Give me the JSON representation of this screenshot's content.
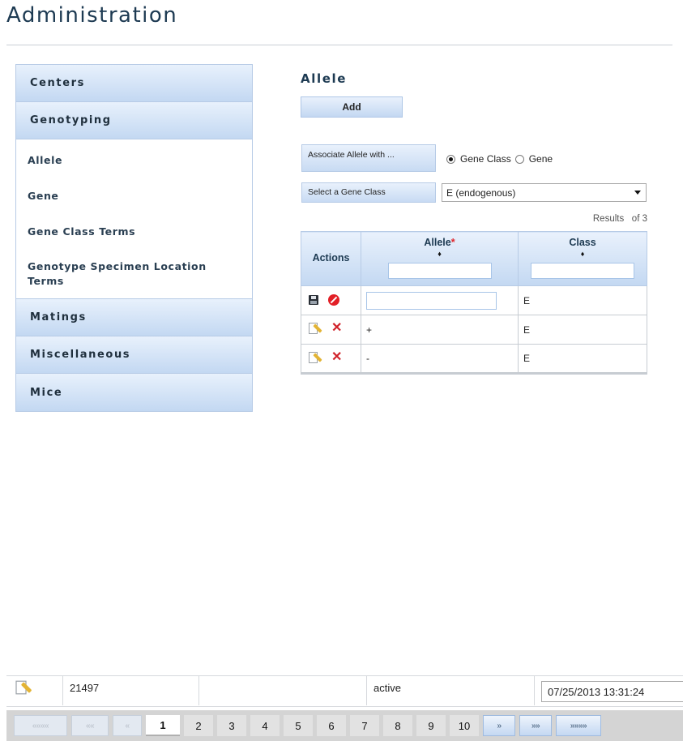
{
  "page": {
    "title": "Administration"
  },
  "sidebar": {
    "sections": [
      {
        "label": "Centers"
      },
      {
        "label": "Genotyping"
      },
      {
        "label": "Matings"
      },
      {
        "label": "Miscellaneous"
      },
      {
        "label": "Mice"
      }
    ],
    "genotyping_items": [
      {
        "label": "Allele"
      },
      {
        "label": "Gene"
      },
      {
        "label": "Gene Class Terms"
      },
      {
        "label": "Genotype Specimen Location Terms"
      }
    ]
  },
  "main": {
    "heading": "Allele",
    "add_label": "Add",
    "associate_label": "Associate Allele with ...",
    "radio_options": [
      {
        "label": "Gene Class",
        "checked": true
      },
      {
        "label": "Gene",
        "checked": false
      }
    ],
    "select_label": "Select a Gene Class",
    "select_value": "E (endogenous)",
    "results_text": "Results   of 3",
    "table": {
      "headers": {
        "actions": "Actions",
        "allele": "Allele",
        "required_mark": "*",
        "class": "Class"
      },
      "sort_icon": "♦",
      "rows": [
        {
          "allele": "",
          "class": "E"
        },
        {
          "allele": "+",
          "class": "E"
        },
        {
          "allele": "-",
          "class": "E"
        }
      ]
    }
  },
  "bottom_row": {
    "id": "21497",
    "status": "active",
    "datetime": "07/25/2013 13:31:24"
  },
  "pager": {
    "first": "««««",
    "prev_fast": "««",
    "prev": "«",
    "pages": [
      "1",
      "2",
      "3",
      "4",
      "5",
      "6",
      "7",
      "8",
      "9",
      "10"
    ],
    "current_page": "1",
    "next": "»",
    "next_fast": "»»",
    "last": "»»»»"
  },
  "icons": {
    "save": "save-icon",
    "cancel": "cancel-icon",
    "edit": "edit-icon",
    "delete": "delete-icon"
  },
  "colors": {
    "accent": "#c3d8f2",
    "title": "#1d3a52",
    "delete": "#d0222a",
    "required": "#e0262b"
  }
}
